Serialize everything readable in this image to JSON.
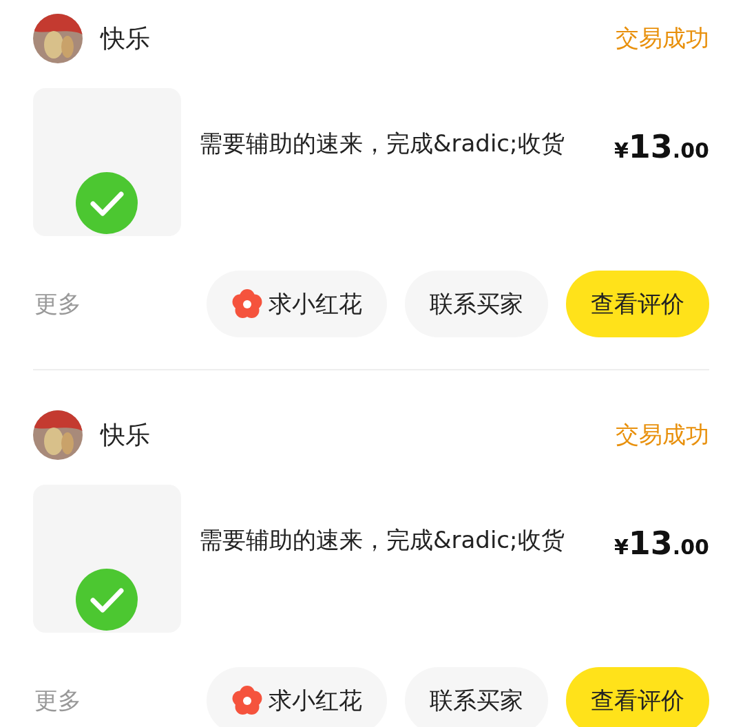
{
  "orders": [
    {
      "buyer": "快乐",
      "status": "交易成功",
      "title": "需要辅助的速来，完成&radic;收货",
      "price": {
        "currency": "¥",
        "integer": "13",
        "decimal": ".00"
      },
      "more": "更多",
      "buttons": [
        {
          "label": "求小红花",
          "kind": "flower"
        },
        {
          "label": "联系买家",
          "kind": "plain"
        },
        {
          "label": "查看评价",
          "kind": "primary"
        }
      ]
    },
    {
      "buyer": "快乐",
      "status": "交易成功",
      "title": "需要辅助的速来，完成&radic;收货",
      "price": {
        "currency": "¥",
        "integer": "13",
        "decimal": ".00"
      },
      "more": "更多",
      "buttons": [
        {
          "label": "求小红花",
          "kind": "flower"
        },
        {
          "label": "联系买家",
          "kind": "plain"
        },
        {
          "label": "查看评价",
          "kind": "primary"
        }
      ]
    }
  ]
}
